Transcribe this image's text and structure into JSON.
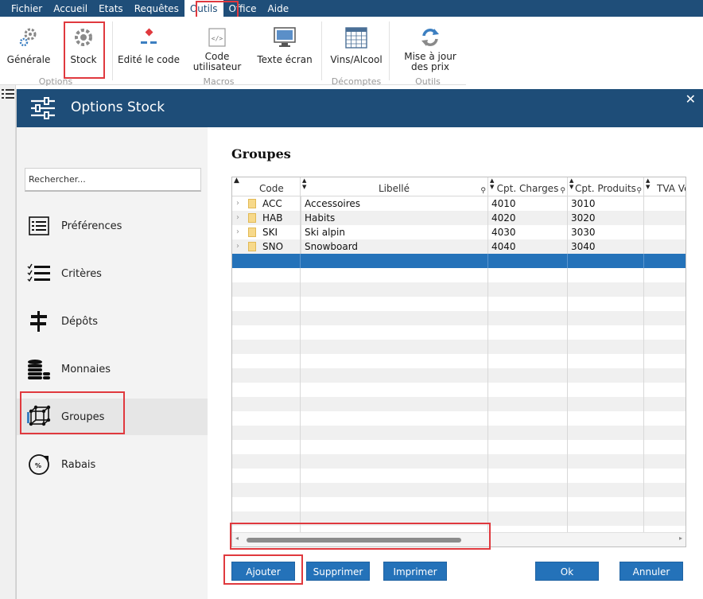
{
  "menu": [
    "Fichier",
    "Accueil",
    "Etats",
    "Requêtes",
    "Outils",
    "Office",
    "Aide"
  ],
  "ribbon": {
    "buttons": {
      "generale": "Générale",
      "stock": "Stock",
      "edite_code": "Edité le code",
      "code_utilisateur_l1": "Code",
      "code_utilisateur_l2": "utilisateur",
      "texte_ecran": "Texte écran",
      "vins_alcool": "Vins/Alcool",
      "mise_a_jour_l1": "Mise à jour",
      "mise_a_jour_l2": "des prix"
    },
    "groups": {
      "options": "Options",
      "macros": "Macros",
      "decomptes": "Décomptes",
      "outils": "Outils"
    }
  },
  "dialog": {
    "title": "Options Stock",
    "close": "✕",
    "search": {
      "placeholder": "Rechercher..."
    },
    "nav": [
      {
        "label": "Préférences",
        "icon": "preferences-list-icon"
      },
      {
        "label": "Critères",
        "icon": "criteria-checklist-icon"
      },
      {
        "label": "Dépôts",
        "icon": "signpost-icon"
      },
      {
        "label": "Monnaies",
        "icon": "coins-stack-icon"
      },
      {
        "label": "Groupes",
        "icon": "group-cube-icon"
      },
      {
        "label": "Rabais",
        "icon": "discount-tag-icon"
      }
    ],
    "selected_nav": "Groupes",
    "section_title": "Groupes",
    "grid": {
      "columns": [
        "Code",
        "Libellé",
        "Cpt. Charges",
        "Cpt. Produits",
        "TVA Ve"
      ],
      "rows": [
        {
          "code": "ACC",
          "libelle": "Accessoires",
          "charges": "4010",
          "produits": "3010"
        },
        {
          "code": "HAB",
          "libelle": "Habits",
          "charges": "4020",
          "produits": "3020"
        },
        {
          "code": "SKI",
          "libelle": "Ski alpin",
          "charges": "4030",
          "produits": "3030"
        },
        {
          "code": "SNO",
          "libelle": "Snowboard",
          "charges": "4040",
          "produits": "3040"
        }
      ]
    },
    "buttons": {
      "ajouter": "Ajouter",
      "supprimer": "Supprimer",
      "imprimer": "Imprimer",
      "ok": "Ok",
      "annuler": "Annuler"
    }
  },
  "colors": {
    "header_blue": "#1e4d78",
    "selection_blue": "#2472b9",
    "highlight_red": "#e0393e"
  }
}
